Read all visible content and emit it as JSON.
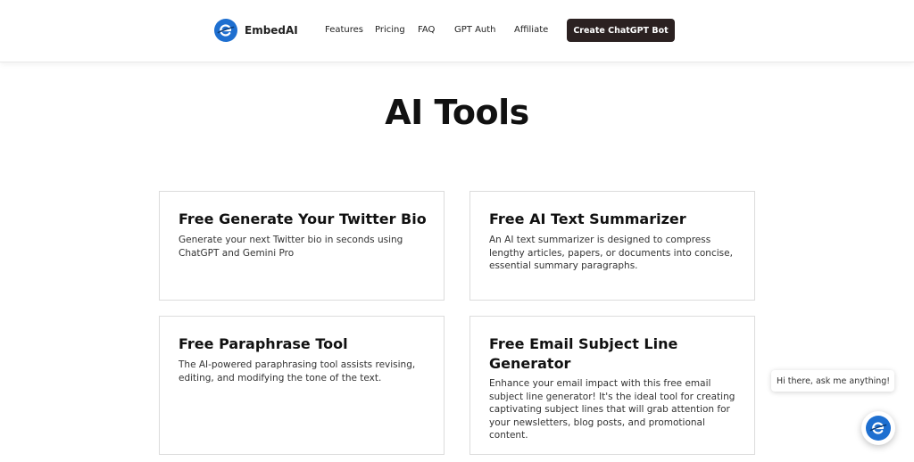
{
  "header": {
    "brand": "EmbedAI",
    "nav": {
      "features": "Features",
      "pricing": "Pricing",
      "faq": "FAQ",
      "gpt_auth": "GPT Auth",
      "affiliate": "Affiliate"
    },
    "cta_label": "Create ChatGPT Bot"
  },
  "main": {
    "title": "AI Tools",
    "cards": [
      {
        "title": "Free Generate Your Twitter Bio",
        "description": "Generate your next Twitter bio in seconds using ChatGPT and Gemini Pro"
      },
      {
        "title": "Free AI Text Summarizer",
        "description": "An AI text summarizer is designed to compress lengthy articles, papers, or documents into concise, essential summary paragraphs."
      },
      {
        "title": "Free Paraphrase Tool",
        "description": "The AI-powered paraphrasing tool assists revising, editing, and modifying the tone of the text."
      },
      {
        "title": "Free Email Subject Line Generator",
        "description": "Enhance your email impact with this free email subject line generator! It's the ideal tool for creating captivating subject lines that will grab attention for your newsletters, blog posts, and promotional content."
      }
    ]
  },
  "chat_widget": {
    "greeting": "Hi there, ask me anything!"
  },
  "colors": {
    "brand_blue": "#1e6fd0",
    "cta_background": "#2b2121"
  },
  "icons": {
    "logo": "embedai-logo-icon",
    "chat": "embedai-chat-icon"
  }
}
